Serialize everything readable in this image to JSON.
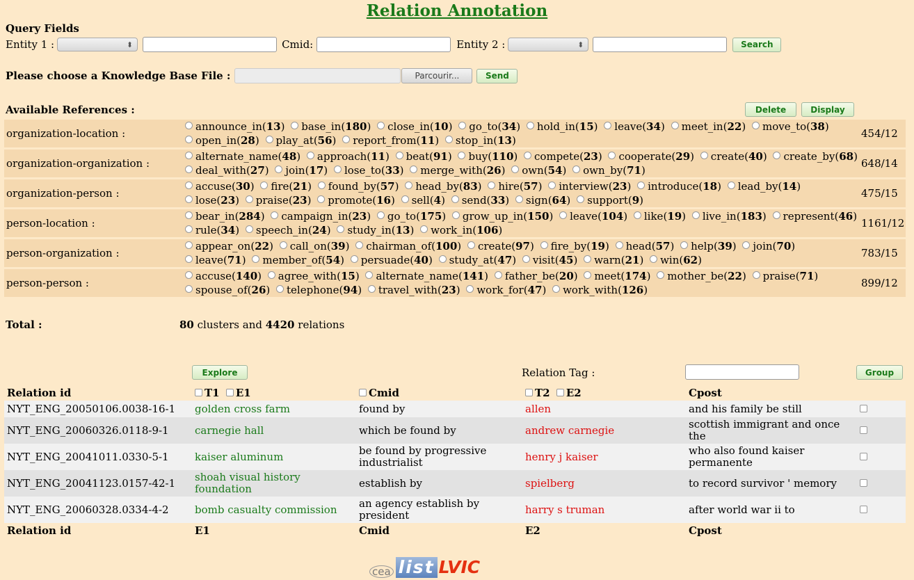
{
  "page": {
    "title": "Relation Annotation"
  },
  "query": {
    "heading": "Query Fields",
    "entity1_label": "Entity 1 :",
    "cmid_label": "Cmid:",
    "entity2_label": "Entity 2 :",
    "search_label": "Search"
  },
  "kb": {
    "label": "Please choose a Knowledge Base File :",
    "browse_label": "Parcourir...",
    "send_label": "Send"
  },
  "refs": {
    "heading": "Available References :",
    "delete_label": "Delete",
    "display_label": "Display",
    "rows": [
      {
        "name": "organization-location :",
        "count": "454/12",
        "items": [
          [
            "announce_in",
            "13"
          ],
          [
            "base_in",
            "180"
          ],
          [
            "close_in",
            "10"
          ],
          [
            "go_to",
            "34"
          ],
          [
            "hold_in",
            "15"
          ],
          [
            "leave",
            "34"
          ],
          [
            "meet_in",
            "22"
          ],
          [
            "move_to",
            "38"
          ],
          [
            "open_in",
            "28"
          ],
          [
            "play_at",
            "56"
          ],
          [
            "report_from",
            "11"
          ],
          [
            "stop_in",
            "13"
          ]
        ]
      },
      {
        "name": "organization-organization :",
        "count": "648/14",
        "items": [
          [
            "alternate_name",
            "48"
          ],
          [
            "approach",
            "11"
          ],
          [
            "beat",
            "91"
          ],
          [
            "buy",
            "110"
          ],
          [
            "compete",
            "23"
          ],
          [
            "cooperate",
            "29"
          ],
          [
            "create",
            "40"
          ],
          [
            "create_by",
            "68"
          ],
          [
            "deal_with",
            "27"
          ],
          [
            "join",
            "17"
          ],
          [
            "lose_to",
            "33"
          ],
          [
            "merge_with",
            "26"
          ],
          [
            "own",
            "54"
          ],
          [
            "own_by",
            "71"
          ]
        ]
      },
      {
        "name": "organization-person :",
        "count": "475/15",
        "items": [
          [
            "accuse",
            "30"
          ],
          [
            "fire",
            "21"
          ],
          [
            "found_by",
            "57"
          ],
          [
            "head_by",
            "83"
          ],
          [
            "hire",
            "57"
          ],
          [
            "interview",
            "23"
          ],
          [
            "introduce",
            "18"
          ],
          [
            "lead_by",
            "14"
          ],
          [
            "lose",
            "23"
          ],
          [
            "praise",
            "23"
          ],
          [
            "promote",
            "16"
          ],
          [
            "sell",
            "4"
          ],
          [
            "send",
            "33"
          ],
          [
            "sign",
            "64"
          ],
          [
            "support",
            "9"
          ]
        ]
      },
      {
        "name": "person-location :",
        "count": "1161/12",
        "items": [
          [
            "bear_in",
            "284"
          ],
          [
            "campaign_in",
            "23"
          ],
          [
            "go_to",
            "175"
          ],
          [
            "grow_up_in",
            "150"
          ],
          [
            "leave",
            "104"
          ],
          [
            "like",
            "19"
          ],
          [
            "live_in",
            "183"
          ],
          [
            "represent",
            "46"
          ],
          [
            "rule",
            "34"
          ],
          [
            "speech_in",
            "24"
          ],
          [
            "study_in",
            "13"
          ],
          [
            "work_in",
            "106"
          ]
        ]
      },
      {
        "name": "person-organization :",
        "count": "783/15",
        "items": [
          [
            "appear_on",
            "22"
          ],
          [
            "call_on",
            "39"
          ],
          [
            "chairman_of",
            "100"
          ],
          [
            "create",
            "97"
          ],
          [
            "fire_by",
            "19"
          ],
          [
            "head",
            "57"
          ],
          [
            "help",
            "39"
          ],
          [
            "join",
            "70"
          ],
          [
            "leave",
            "71"
          ],
          [
            "member_of",
            "54"
          ],
          [
            "persuade",
            "40"
          ],
          [
            "study_at",
            "47"
          ],
          [
            "visit",
            "45"
          ],
          [
            "warn",
            "21"
          ],
          [
            "win",
            "62"
          ]
        ]
      },
      {
        "name": "person-person :",
        "count": "899/12",
        "items": [
          [
            "accuse",
            "140"
          ],
          [
            "agree_with",
            "15"
          ],
          [
            "alternate_name",
            "141"
          ],
          [
            "father_be",
            "20"
          ],
          [
            "meet",
            "174"
          ],
          [
            "mother_be",
            "22"
          ],
          [
            "praise",
            "71"
          ],
          [
            "spouse_of",
            "26"
          ],
          [
            "telephone",
            "94"
          ],
          [
            "travel_with",
            "23"
          ],
          [
            "work_for",
            "47"
          ],
          [
            "work_with",
            "126"
          ]
        ]
      }
    ],
    "total_label": "Total :",
    "total_clusters": "80",
    "total_mid": "clusters and",
    "total_relations": "4420",
    "total_end": "relations"
  },
  "explore": {
    "explore_label": "Explore",
    "relation_tag_label": "Relation Tag :",
    "group_label": "Group"
  },
  "results": {
    "header": {
      "id": "Relation id",
      "t1": "T1",
      "e1": "E1",
      "cmid": "Cmid",
      "t2": "T2",
      "e2": "E2",
      "cpost": "Cpost"
    },
    "footer": {
      "id": "Relation id",
      "e1": "E1",
      "cmid": "Cmid",
      "e2": "E2",
      "cpost": "Cpost"
    },
    "rows": [
      {
        "id": "NYT_ENG_20050106.0038-16-1",
        "e1": "golden cross farm",
        "cmid": "found by",
        "e2": "allen",
        "cpost": "and his family be still"
      },
      {
        "id": "NYT_ENG_20060326.0118-9-1",
        "e1": "carnegie hall",
        "cmid": "which be found by",
        "e2": "andrew carnegie",
        "cpost": "scottish immigrant and once the"
      },
      {
        "id": "NYT_ENG_20041011.0330-5-1",
        "e1": "kaiser aluminum",
        "cmid": "be found by progressive industrialist",
        "e2": "henry j kaiser",
        "cpost": "who also found kaiser permanente"
      },
      {
        "id": "NYT_ENG_20041123.0157-42-1",
        "e1": "shoah visual history foundation",
        "cmid": "establish by",
        "e2": "spielberg",
        "cpost": "to record survivor ' memory"
      },
      {
        "id": "NYT_ENG_20060328.0334-4-2",
        "e1": "bomb casualty commission",
        "cmid": "an agency establish by president",
        "e2": "harry s truman",
        "cpost": "after world war ii to"
      }
    ]
  },
  "logo": {
    "cea": "cea",
    "list": "list",
    "lvic": "LVIC"
  },
  "colors": {
    "background": "#fde9c9",
    "row_band": "#f5d9b0",
    "green": "#1a7a1a",
    "red": "#dd1111"
  }
}
